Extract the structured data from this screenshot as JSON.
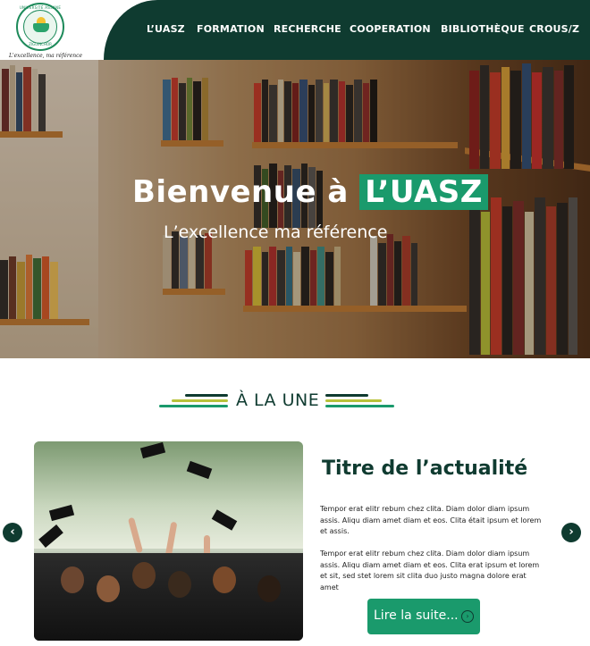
{
  "logo": {
    "ring_text": "UNIVERSITÉ ASSANE SECK",
    "ring_bottom": "ZIGUINCHOR",
    "motto": "L'excellence, ma référence"
  },
  "nav": {
    "items": [
      "L’UASZ",
      "FORMATION",
      "RECHERCHE",
      "COOPERATION",
      "BIBLIOTHÈQUE",
      "CROUS/Z"
    ]
  },
  "hero": {
    "title_prefix": "Bienvenue à",
    "title_highlight": "L’UASZ",
    "subtitle": "L’excellence ma référence"
  },
  "section": {
    "title": "À LA UNE"
  },
  "news": {
    "title": "Titre de l’actualité",
    "paragraph_1": "Tempor erat elitr rebum chez clita. Diam dolor diam ipsum assis. Aliqu diam amet diam et eos. Clita était ipsum et lorem et assis.",
    "paragraph_2": "Tempor erat elitr rebum chez clita. Diam dolor diam ipsum assis. Aliqu diam amet diam et eos. Clita erat ipsum et lorem et sit, sed stet lorem sit clita duo justo magna dolore erat amet",
    "read_more": "Lire la suite...",
    "prev_icon": "‹",
    "next_icon": "›"
  },
  "colors": {
    "brand_dark": "#0f3b30",
    "brand_green": "#1a9a6c",
    "accent_yellow": "#b8c23a"
  }
}
